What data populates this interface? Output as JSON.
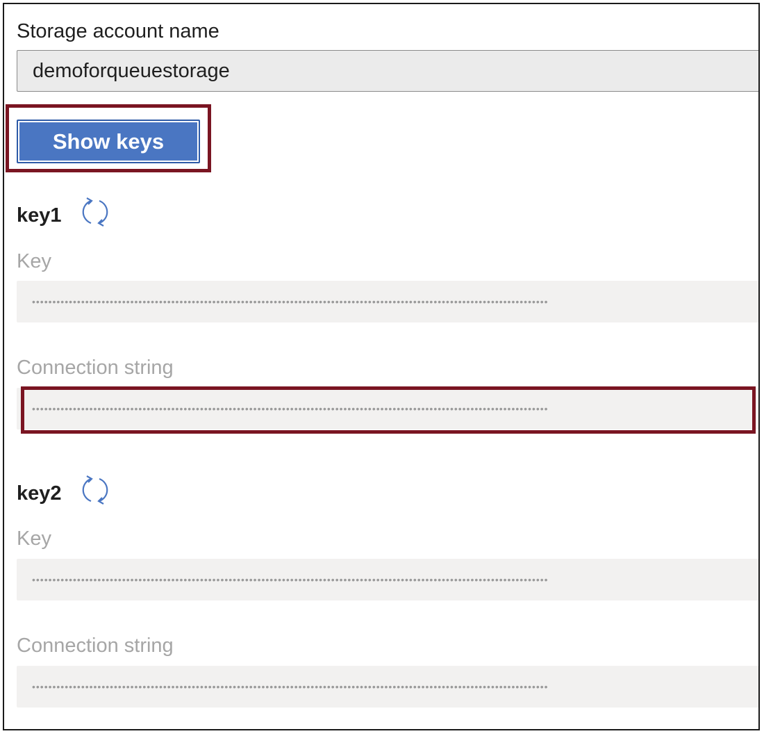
{
  "storage": {
    "label": "Storage account name",
    "value": "demoforqueuestorage"
  },
  "show_keys_button": "Show keys",
  "keys": [
    {
      "title": "key1",
      "key_label": "Key",
      "key_value": "••••••••••••••••••••••••••••••••••••••••••••••••••••••••••••••••••••••••••••••••••••••••••••••••••••••••••••••••••••••••••••••",
      "conn_label": "Connection string",
      "conn_value": "••••••••••••••••••••••••••••••••••••••••••••••••••••••••••••••••••••••••••••••••••••••••••••••••••••••••••••••••••••••••••••••"
    },
    {
      "title": "key2",
      "key_label": "Key",
      "key_value": "••••••••••••••••••••••••••••••••••••••••••••••••••••••••••••••••••••••••••••••••••••••••••••••••••••••••••••••••••••••••••••••",
      "conn_label": "Connection string",
      "conn_value": "••••••••••••••••••••••••••••••••••••••••••••••••••••••••••••••••••••••••••••••••••••••••••••••••••••••••••••••••••••••••••••••"
    }
  ],
  "icons": {
    "refresh": "refresh-icon"
  },
  "colors": {
    "primary_button": "#4a76c2",
    "highlight_border": "#7a1522",
    "refresh_icon": "#4a76c2"
  }
}
